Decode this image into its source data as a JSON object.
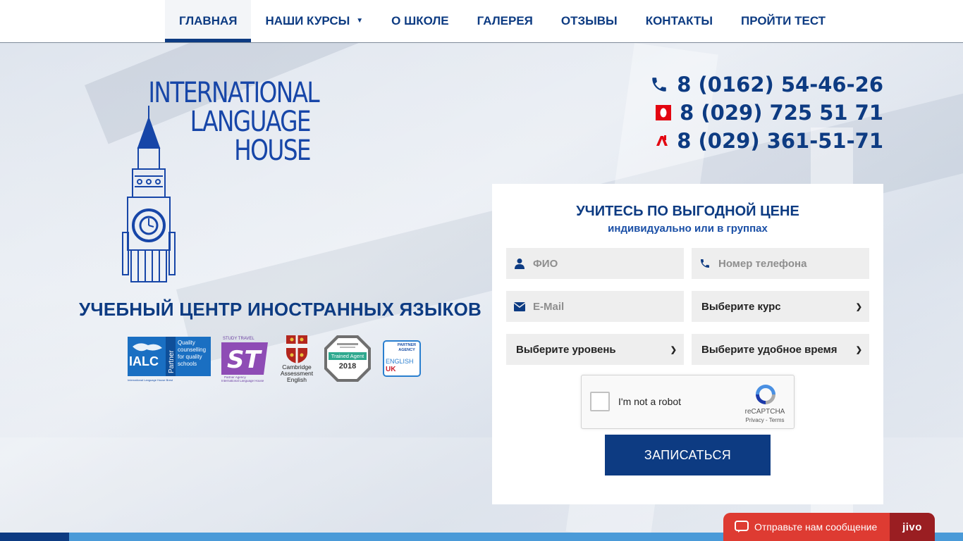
{
  "nav": {
    "items": [
      {
        "label": "ГЛАВНАЯ",
        "active": true
      },
      {
        "label": "НАШИ КУРСЫ",
        "dropdown": true
      },
      {
        "label": "О ШКОЛЕ"
      },
      {
        "label": "ГАЛЕРЕЯ"
      },
      {
        "label": "ОТЗЫВЫ"
      },
      {
        "label": "КОНТАКТЫ"
      },
      {
        "label": "ПРОЙТИ ТЕСТ"
      }
    ]
  },
  "logo": {
    "line1": "INTERNATIONAL",
    "line2": "LANGUAGE",
    "line3": "HOUSE",
    "icon": "big-ben-icon"
  },
  "school_title": "УЧЕБНЫЙ ЦЕНТР ИНОСТРАННЫХ ЯЗЫКОВ",
  "partners": {
    "ialc": {
      "name": "IALC",
      "side": "Partner",
      "text1": "Quality",
      "text2": "counselling",
      "text3": "for quality",
      "text4": "schools",
      "caption": "International Language House Brest"
    },
    "st": {
      "top": "STUDY TRAVEL",
      "name": "ST",
      "caption1": "Partner Agency",
      "caption2": "International Language House"
    },
    "cambridge": {
      "line1": "Cambridge",
      "line2": "Assessment",
      "line3": "English"
    },
    "trained": {
      "label": "Trained Agent",
      "year": "2018"
    },
    "englishuk": {
      "top1": "PARTNER",
      "top2": "AGENCY",
      "word": "ENGLISH",
      "uk": "UK"
    }
  },
  "phones": [
    {
      "number": "8 (0162) 54-46-26",
      "icon": "phone-icon"
    },
    {
      "number": "8 (029) 725 51 71",
      "icon": "mts-icon"
    },
    {
      "number": "8 (029) 361-51-71",
      "icon": "a1-icon"
    }
  ],
  "form": {
    "title": "УЧИТЕСЬ ПО ВЫГОДНОЙ ЦЕНЕ",
    "subtitle": "индивидуально или в группах",
    "name_placeholder": "ФИО",
    "phone_placeholder": "Номер телефона",
    "email_placeholder": "E-Mail",
    "course_select": "Выберите курс",
    "level_select": "Выберите уровень",
    "time_select": "Выберите удобное время",
    "captcha_label": "I'm not a robot",
    "captcha_brand": "reCAPTCHA",
    "captcha_links": "Privacy - Terms",
    "submit_label": "ЗАПИСАТЬСЯ"
  },
  "chat": {
    "message": "Отправьте нам сообщение",
    "brand": "jivo"
  },
  "colors": {
    "brand_blue": "#0d3b82",
    "accent_red": "#de3b32",
    "bar_blue": "#4a9ad8"
  }
}
